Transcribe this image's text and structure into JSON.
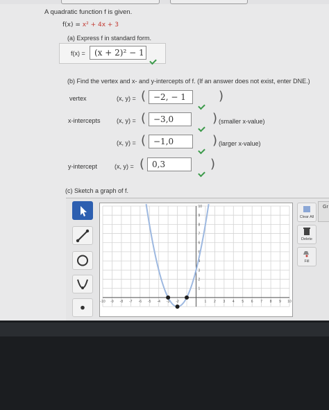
{
  "question": {
    "intro": "A quadratic function f is given.",
    "function_lhs": "f(x) = ",
    "function_rhs": "x² + 4x + 3"
  },
  "part_a": {
    "prompt": "(a) Express f in standard form.",
    "label": "f(x) =",
    "answer": "(x + 2)² − 1",
    "correct": true
  },
  "part_b": {
    "prompt": "(b) Find the vertex and x- and y-intercepts of f. (If an answer does not exist, enter DNE.)",
    "coord_label": "(x, y) =",
    "vertex": {
      "label": "vertex",
      "value": "−2, − 1",
      "correct": true
    },
    "x_intercepts": {
      "label": "x-intercepts",
      "smaller": {
        "value": "−3,0",
        "note": "(smaller x-value)",
        "correct": true
      },
      "larger": {
        "value": "−1,0",
        "note": "(larger x-value)",
        "correct": true
      }
    },
    "y_intercept": {
      "label": "y-intercept",
      "value": "0,3",
      "correct": true
    }
  },
  "part_c": {
    "prompt": "(c) Sketch a graph of f.",
    "tools": [
      "pointer-tool",
      "line-tool",
      "circle-tool",
      "parabola-tool",
      "point-tool"
    ],
    "right_buttons": {
      "clear_all": "Clear All",
      "delete": "Delete",
      "fill": "Fill"
    },
    "side_tab": "Gr",
    "graph": {
      "x_range": [
        -10,
        10
      ],
      "y_range": [
        -1,
        10
      ],
      "x_tick_labels": [
        "-10",
        "-9",
        "-8",
        "-7",
        "-6",
        "-5",
        "-4",
        "-3",
        "-2",
        "",
        "1",
        "2",
        "3",
        "4",
        "5",
        "6",
        "7",
        "8",
        "9",
        "10"
      ],
      "y_tick_labels": [
        "10",
        "9",
        "8",
        "7",
        "6",
        "5",
        "4",
        "3",
        "2",
        "1"
      ],
      "curve_color": "#9db8e0",
      "points": [
        {
          "x": -3,
          "y": 0
        },
        {
          "x": -1,
          "y": 0
        },
        {
          "x": -2,
          "y": -1
        }
      ]
    }
  },
  "colors": {
    "accent_active_tool": "#2d5fb0",
    "check_green": "#3c9a4b",
    "function_red": "#c23b34"
  }
}
